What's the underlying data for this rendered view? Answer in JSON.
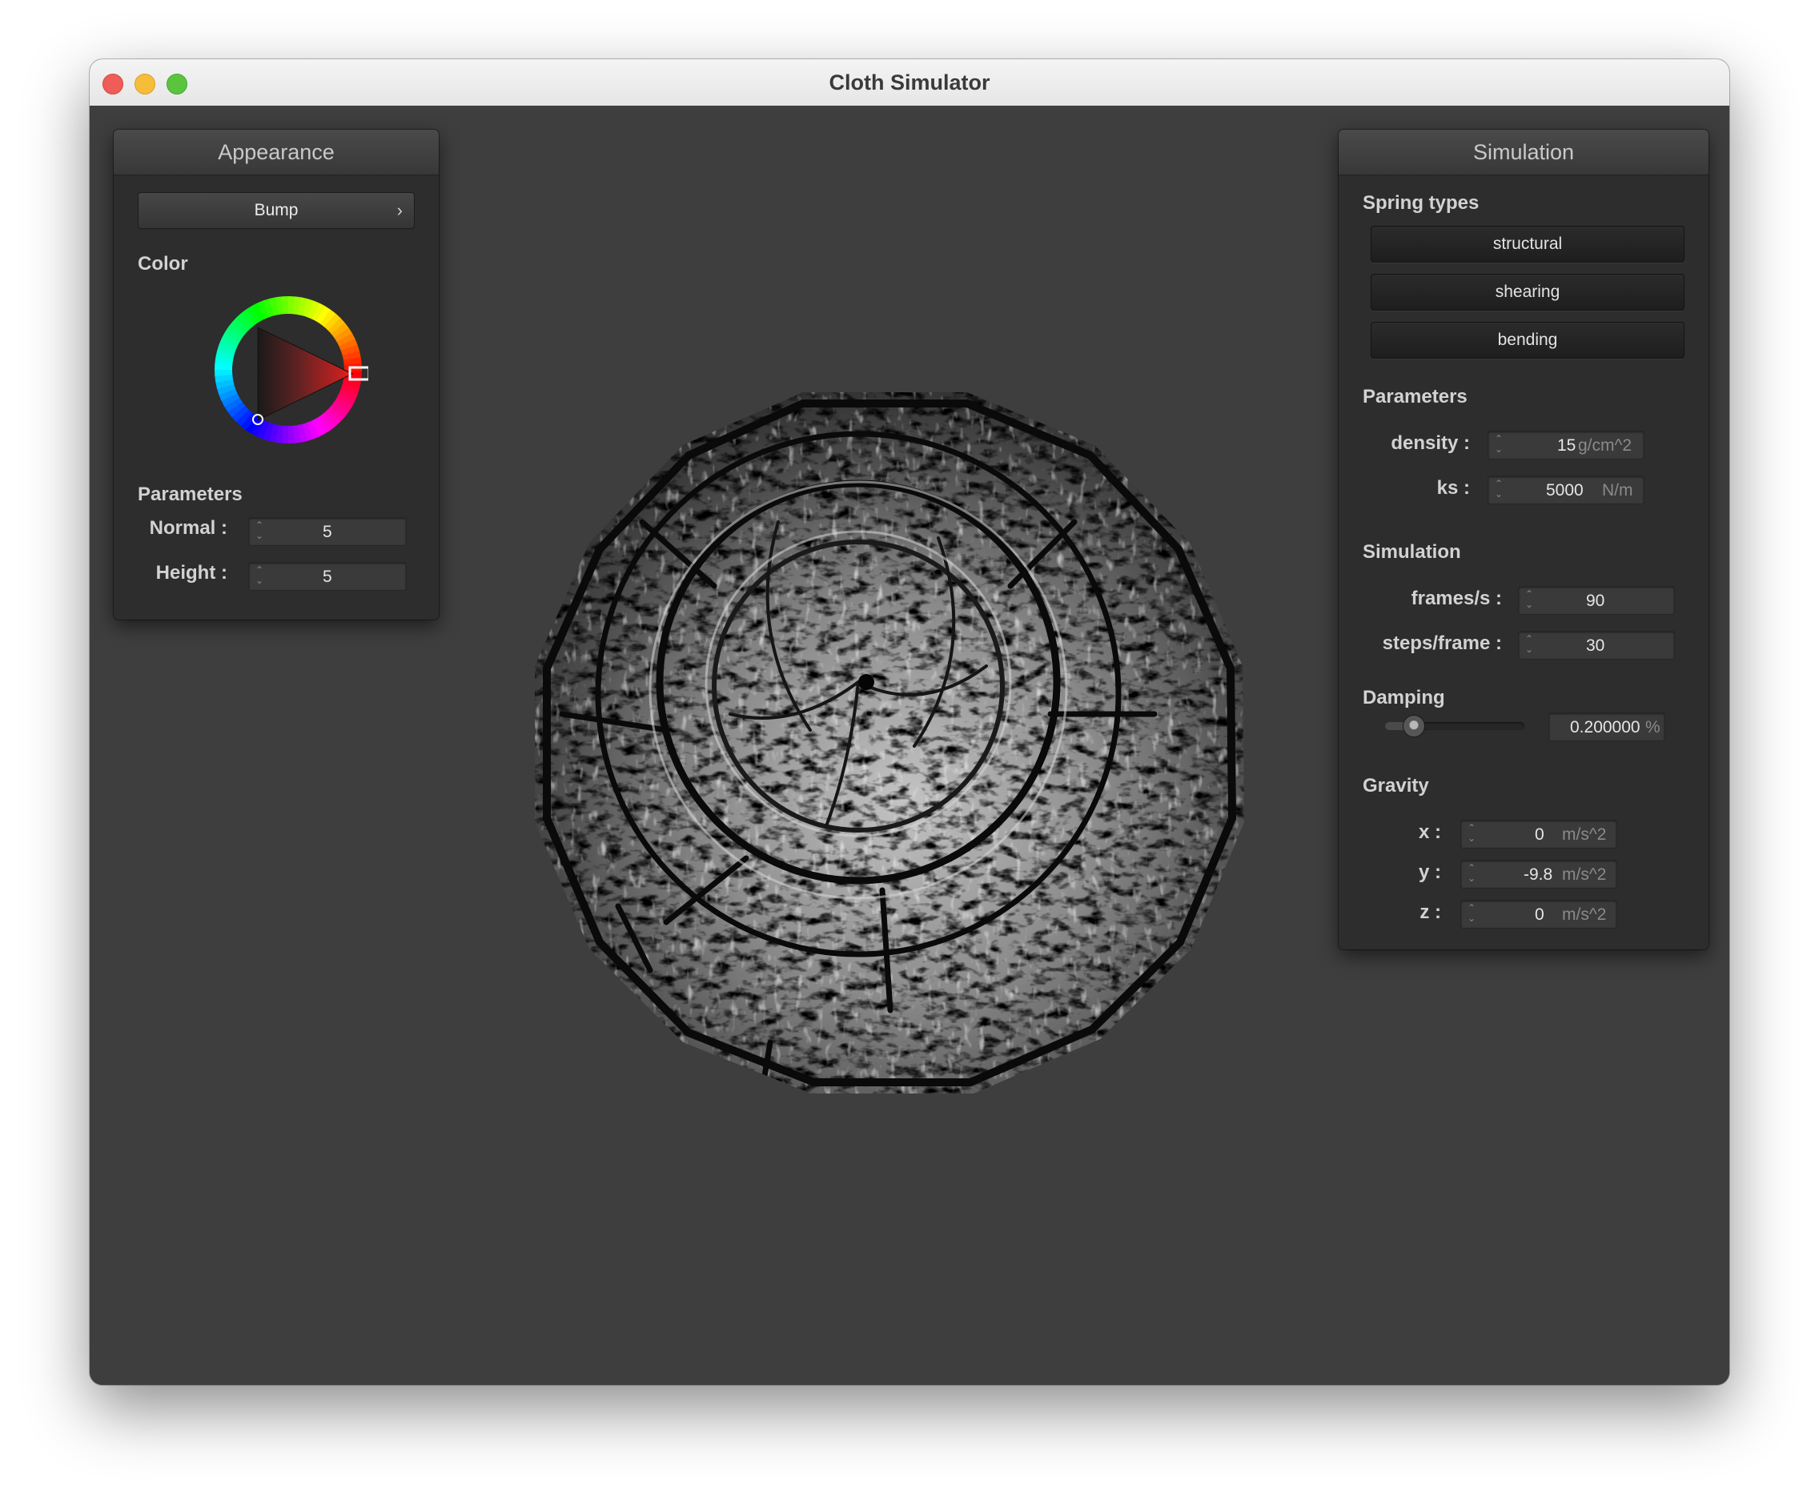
{
  "window": {
    "title": "Cloth Simulator"
  },
  "appearance": {
    "title": "Appearance",
    "shader": "Bump",
    "color_label": "Color",
    "color_value": "#c81e1e",
    "params_label": "Parameters",
    "normal": {
      "label": "Normal :",
      "value": "5"
    },
    "height": {
      "label": "Height :",
      "value": "5"
    }
  },
  "simulation": {
    "title": "Simulation",
    "spring_types_label": "Spring types",
    "springs": [
      "structural",
      "shearing",
      "bending"
    ],
    "params_label": "Parameters",
    "density": {
      "label": "density :",
      "value": "15",
      "unit": "g/cm^2"
    },
    "ks": {
      "label": "ks :",
      "value": "5000",
      "unit": "N/m"
    },
    "sim_label": "Simulation",
    "fps": {
      "label": "frames/s :",
      "value": "90"
    },
    "steps": {
      "label": "steps/frame :",
      "value": "30"
    },
    "damping_label": "Damping",
    "damping": {
      "value": "0.200000",
      "unit": "%",
      "level": 0.2
    },
    "gravity_label": "Gravity",
    "gx": {
      "label": "x :",
      "value": "0",
      "unit": "m/s^2"
    },
    "gy": {
      "label": "y :",
      "value": "-9.8",
      "unit": "m/s^2"
    },
    "gz": {
      "label": "z :",
      "value": "0",
      "unit": "m/s^2"
    }
  }
}
